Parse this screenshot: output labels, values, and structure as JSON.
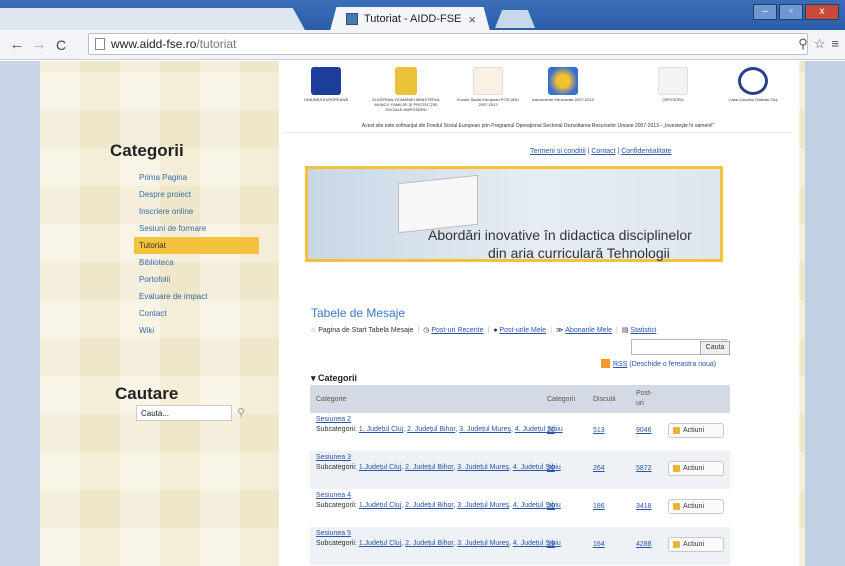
{
  "browser": {
    "tab_title": "Tutoriat - AIDD-FSE",
    "url_host": "www.aidd-fse.ro",
    "url_path": "/tutoriat"
  },
  "sidebar": {
    "title": "Categorii",
    "items": [
      {
        "label": "Prima Pagina"
      },
      {
        "label": "Despre proiect"
      },
      {
        "label": "Inscriere online"
      },
      {
        "label": "Sesiuni de formare"
      },
      {
        "label": "Tutoriat"
      },
      {
        "label": "Biblioteca"
      },
      {
        "label": "Portofolii"
      },
      {
        "label": "Evaluare de impact"
      },
      {
        "label": "Contact"
      },
      {
        "label": "Wiki"
      }
    ],
    "search_title": "Cautare",
    "search_placeholder": "Cauta..."
  },
  "logos": [
    {
      "label": "UNIUNEA EUROPEANĂ"
    },
    {
      "label": "GUVERNUL ROMÂNIEI MINISTERUL MUNCII, FAMILIEI ŞI PROTECŢIEI SOCIALE AMPOSDRU"
    },
    {
      "label": "Fondul Social European POS DRU 2007-2013"
    },
    {
      "label": "Instrumente Structurale 2007-2013"
    },
    {
      "label": "OIPOSDRU"
    },
    {
      "label": "Casa Corpului Didactic Cluj"
    }
  ],
  "cofinance_text": "Acest site este cofinanţat din Fondul Social European prin Programul Operaţional Sectorial Dezvoltarea Resurselor Umane 2007-2013 - „Investeşte în oameni!”",
  "toplinks": [
    "Termeni si conditii",
    "Contact",
    "Confidentialitate"
  ],
  "banner": {
    "line1": "Abordări inovative în didactica disciplinelor",
    "line2": "din aria curriculară Tehnologii"
  },
  "forum": {
    "title": "Tabele de Mesaje",
    "nav": [
      "Pagina de Start Tabela Mesaje",
      "Post-uri Recente",
      "Post-urile Mele",
      "Abonarile Mele",
      "Statistici"
    ],
    "search_button": "Cauta",
    "rss": "RSS",
    "rss_note": "(Deschide o fereastra noua)",
    "categories_header": "▾ Categorii",
    "columns": [
      "Categorie",
      "Categorii",
      "Discutii",
      "Post-uri"
    ],
    "rows": [
      {
        "name": "Sesiunea 2",
        "subs_label": "Subcategorii",
        "subs": [
          "1. Judeţul Cluj",
          "2. Judeţul Bihor",
          "3. Judeţul Mureş",
          "4. Judeţul Sibiu"
        ],
        "categorii": "20",
        "discutii": "513",
        "posturi": "9046",
        "action": "Actiuni"
      },
      {
        "name": "Sesiunea 3",
        "subs_label": "Subcategorii",
        "subs": [
          "1.Judeţul Cluj",
          "2. Judeţul Bihor",
          "3. Judeţul Mureş",
          "4. Judeţul Sibiu"
        ],
        "categorii": "20",
        "discutii": "264",
        "posturi": "5872",
        "action": "Actiuni"
      },
      {
        "name": "Sesiunea 4",
        "subs_label": "Subcategorii",
        "subs": [
          "1.Judeţul Cluj",
          "2. Judeţul Bihor",
          "3. Judeţul Mureş",
          "4. Judeţul Sibiu"
        ],
        "categorii": "20",
        "discutii": "186",
        "posturi": "3418",
        "action": "Actiuni"
      },
      {
        "name": "Sesiunea 5",
        "subs_label": "Subcategorii",
        "subs": [
          "1.Judeţul Cluj",
          "2. Judeţul Bihor",
          "3. Judeţul Mureş",
          "4. Judeţul Sibiu"
        ],
        "categorii": "19",
        "discutii": "164",
        "posturi": "4288",
        "action": "Actiuni"
      }
    ]
  }
}
